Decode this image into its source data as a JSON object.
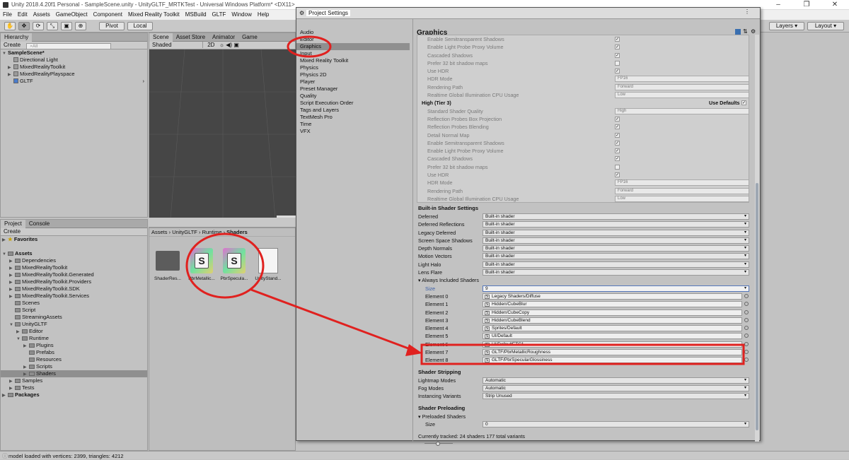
{
  "window": {
    "title": "Unity 2018.4.20f1 Personal - SampleScene.unity - UnityGLTF_MRTKTest - Universal Windows Platform* <DX11>"
  },
  "menu": [
    "File",
    "Edit",
    "Assets",
    "GameObject",
    "Component",
    "Mixed Reality Toolkit",
    "MSBuild",
    "GLTF",
    "Window",
    "Help"
  ],
  "toolbar": {
    "pivot": "Pivot",
    "local": "Local",
    "layers": "Layers",
    "layout": "Layout"
  },
  "hierarchy": {
    "tab": "Hierarchy",
    "create": "Create",
    "search": "All",
    "scene": "SampleScene*",
    "items": [
      "Directional Light",
      "MixedRealityToolkit",
      "MixedRealityPlayspace",
      "GLTF"
    ]
  },
  "scene": {
    "tabs": [
      "Scene",
      "Asset Store",
      "Animator",
      "Game"
    ],
    "shading": "Shaded",
    "mode2d": "2D"
  },
  "project": {
    "tabs": [
      "Project",
      "Console"
    ],
    "create": "Create",
    "favorites": "Favorites",
    "tree": [
      "Assets",
      "Dependencies",
      "MixedRealityToolkit",
      "MixedRealityToolkit.Generated",
      "MixedRealityToolkit.Providers",
      "MixedRealityToolkit.SDK",
      "MixedRealityToolkit.Services",
      "Scenes",
      "Script",
      "StreamingAssets",
      "UnityGLTF",
      "Editor",
      "Runtime",
      "Plugins",
      "Prefabs",
      "Resources",
      "Scripts",
      "Shaders",
      "Samples",
      "Tests",
      "Packages"
    ],
    "breadcrumb": [
      "Assets",
      "UnityGLTF",
      "Runtime",
      "Shaders"
    ],
    "assets": [
      "ShaderRes...",
      "PbrMetallic...",
      "PbrSpecula...",
      "UnityStand..."
    ]
  },
  "settings": {
    "title": "Project Settings",
    "heading": "Graphics",
    "nav": [
      "Audio",
      "Editor",
      "Graphics",
      "Input",
      "Mixed Reality Toolkit",
      "Physics",
      "Physics 2D",
      "Player",
      "Preset Manager",
      "Quality",
      "Script Execution Order",
      "Tags and Layers",
      "TextMesh Pro",
      "Time",
      "VFX"
    ],
    "tier_top": [
      {
        "l": "Enable Semitransparent Shadows",
        "c": true
      },
      {
        "l": "Enable Light Probe Proxy Volume",
        "c": true
      },
      {
        "l": "Cascaded Shadows",
        "c": true
      },
      {
        "l": "Prefer 32 bit shadow maps",
        "c": false
      },
      {
        "l": "Use HDR",
        "c": true
      },
      {
        "l": "HDR Mode",
        "d": "FP16"
      },
      {
        "l": "Rendering Path",
        "d": "Forward"
      },
      {
        "l": "Realtime Global Illumination CPU Usage",
        "d": "Low"
      }
    ],
    "tier3_label": "High (Tier 3)",
    "use_defaults": "Use Defaults",
    "tier3": [
      {
        "l": "Standard Shader Quality",
        "d": "High"
      },
      {
        "l": "Reflection Probes Box Projection",
        "c": true
      },
      {
        "l": "Reflection Probes Blending",
        "c": true
      },
      {
        "l": "Detail Normal Map",
        "c": true
      },
      {
        "l": "Enable Semitransparent Shadows",
        "c": true
      },
      {
        "l": "Enable Light Probe Proxy Volume",
        "c": true
      },
      {
        "l": "Cascaded Shadows",
        "c": true
      },
      {
        "l": "Prefer 32 bit shadow maps",
        "c": false
      },
      {
        "l": "Use HDR",
        "c": true
      },
      {
        "l": "HDR Mode",
        "d": "FP16"
      },
      {
        "l": "Rendering Path",
        "d": "Forward"
      },
      {
        "l": "Realtime Global Illumination CPU Usage",
        "d": "Low"
      }
    ],
    "builtin_header": "Built-in Shader Settings",
    "builtin": [
      {
        "l": "Deferred",
        "v": "Built-in shader"
      },
      {
        "l": "Deferred Reflections",
        "v": "Built-in shader"
      },
      {
        "l": "Legacy Deferred",
        "v": "Built-in shader"
      },
      {
        "l": "Screen Space Shadows",
        "v": "Built-in shader"
      },
      {
        "l": "Depth Normals",
        "v": "Built-in shader"
      },
      {
        "l": "Motion Vectors",
        "v": "Built-in shader"
      },
      {
        "l": "Light Halo",
        "v": "Built-in shader"
      },
      {
        "l": "Lens Flare",
        "v": "Built-in shader"
      }
    ],
    "always_label": "Always Included Shaders",
    "size_label": "Size",
    "size_value": "9",
    "elements": [
      {
        "l": "Element 0",
        "v": "Legacy Shaders/Diffuse"
      },
      {
        "l": "Element 1",
        "v": "Hidden/CubeBlur"
      },
      {
        "l": "Element 2",
        "v": "Hidden/CubeCopy"
      },
      {
        "l": "Element 3",
        "v": "Hidden/CubeBlend"
      },
      {
        "l": "Element 4",
        "v": "Sprites/Default"
      },
      {
        "l": "Element 5",
        "v": "UI/Default"
      },
      {
        "l": "Element 6",
        "v": "UI/DefaultETC1"
      },
      {
        "l": "Element 7",
        "v": "GLTF/PbrMetallicRoughness"
      },
      {
        "l": "Element 8",
        "v": "GLTF/PbrSpecularGlossiness"
      }
    ],
    "stripping_header": "Shader Stripping",
    "stripping": [
      {
        "l": "Lightmap Modes",
        "v": "Automatic"
      },
      {
        "l": "Fog Modes",
        "v": "Automatic"
      },
      {
        "l": "Instancing Variants",
        "v": "Strip Unused"
      }
    ],
    "preload_header": "Shader Preloading",
    "preloaded_label": "Preloaded Shaders",
    "preload_size": "0",
    "tracked": "Currently tracked: 24 shaders 177 total variants"
  },
  "status": "model loaded with vertices: 2399, triangles: 4212",
  "colors": {
    "annotation": "#e0211f"
  }
}
